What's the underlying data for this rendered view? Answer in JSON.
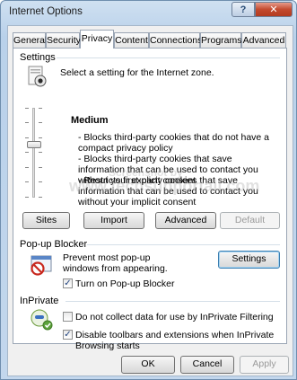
{
  "window": {
    "title": "Internet Options",
    "help_label": "?",
    "close_label": "✕"
  },
  "tabs": [
    {
      "label": "General"
    },
    {
      "label": "Security"
    },
    {
      "label": "Privacy"
    },
    {
      "label": "Content"
    },
    {
      "label": "Connections"
    },
    {
      "label": "Programs"
    },
    {
      "label": "Advanced"
    }
  ],
  "active_tab": "Privacy",
  "settings": {
    "group_label": "Settings",
    "instruction": "Select a setting for the Internet zone.",
    "level": "Medium",
    "bullets": [
      "- Blocks third-party cookies that do not have a compact privacy policy",
      "- Blocks third-party cookies that save information that can be used to contact you without your explicit consent",
      "- Restricts first-party cookies that save information that can be used to contact you without your implicit consent"
    ],
    "buttons": {
      "sites": "Sites",
      "import": "Import",
      "advanced": "Advanced",
      "default": "Default"
    }
  },
  "popup_blocker": {
    "group_label": "Pop-up Blocker",
    "description": "Prevent most pop-up windows from appearing.",
    "settings_button": "Settings",
    "turn_on_label": "Turn on Pop-up Blocker",
    "turn_on_checked": true
  },
  "inprivate": {
    "group_label": "InPrivate",
    "no_collect_label": "Do not collect data for use by InPrivate Filtering",
    "no_collect_checked": false,
    "disable_toolbars_label": "Disable toolbars and extensions when InPrivate Browsing starts",
    "disable_toolbars_checked": true
  },
  "footer": {
    "ok": "OK",
    "cancel": "Cancel",
    "apply": "Apply"
  },
  "watermark": {
    "line1": "Screenshot by",
    "line2": "www.techsupportall.com"
  },
  "icons": {
    "privacy": "eye-privacy-icon",
    "popup": "no-popup-icon",
    "inprivate": "inprivate-icon"
  },
  "colors": {
    "title_bar": "#b9d1ea",
    "close_button": "#c34a2f",
    "checkmark": "#20437f"
  }
}
